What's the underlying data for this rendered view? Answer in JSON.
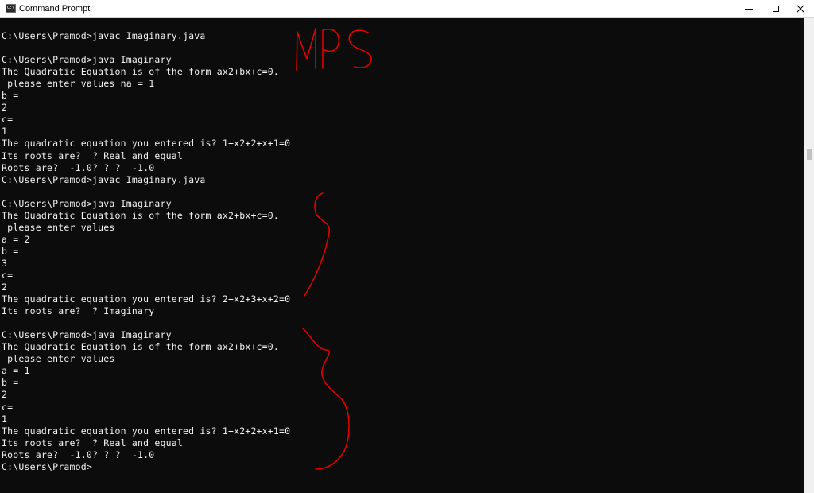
{
  "window": {
    "title": "Command Prompt",
    "icon": "cmd-icon",
    "controls": [
      "minimize-icon",
      "maximize-icon",
      "close-icon"
    ]
  },
  "console": {
    "lines": [
      "",
      "C:\\Users\\Pramod>javac Imaginary.java",
      "",
      "C:\\Users\\Pramod>java Imaginary",
      "The Quadratic Equation is of the form ax2+bx+c=0.",
      " please enter values na = 1",
      "b =",
      "2",
      "c=",
      "1",
      "The quadratic equation you entered is? 1+x2+2+x+1=0",
      "Its roots are?  ? Real and equal",
      "Roots are?  -1.0? ? ?  -1.0",
      "C:\\Users\\Pramod>javac Imaginary.java",
      "",
      "C:\\Users\\Pramod>java Imaginary",
      "The Quadratic Equation is of the form ax2+bx+c=0.",
      " please enter values",
      "a = 2",
      "b =",
      "3",
      "c=",
      "2",
      "The quadratic equation you entered is? 2+x2+3+x+2=0",
      "Its roots are?  ? Imaginary",
      "",
      "C:\\Users\\Pramod>java Imaginary",
      "The Quadratic Equation is of the form ax2+bx+c=0.",
      " please enter values",
      "a = 1",
      "b =",
      "2",
      "c=",
      "1",
      "The quadratic equation you entered is? 1+x2+2+x+1=0",
      "Its roots are?  ? Real and equal",
      "Roots are?  -1.0? ? ?  -1.0",
      "C:\\Users\\Pramod>"
    ]
  },
  "annotations": {
    "color": "#e00000",
    "handwritten_text": "MPS",
    "marks": [
      "mps-handwriting",
      "brace-first-run",
      "brace-second-run"
    ]
  },
  "colors": {
    "console_background": "#0c0c0c",
    "console_text": "#f2f2f2",
    "titlebar": "#ffffff",
    "scrollbar": "#f0f0f0"
  }
}
